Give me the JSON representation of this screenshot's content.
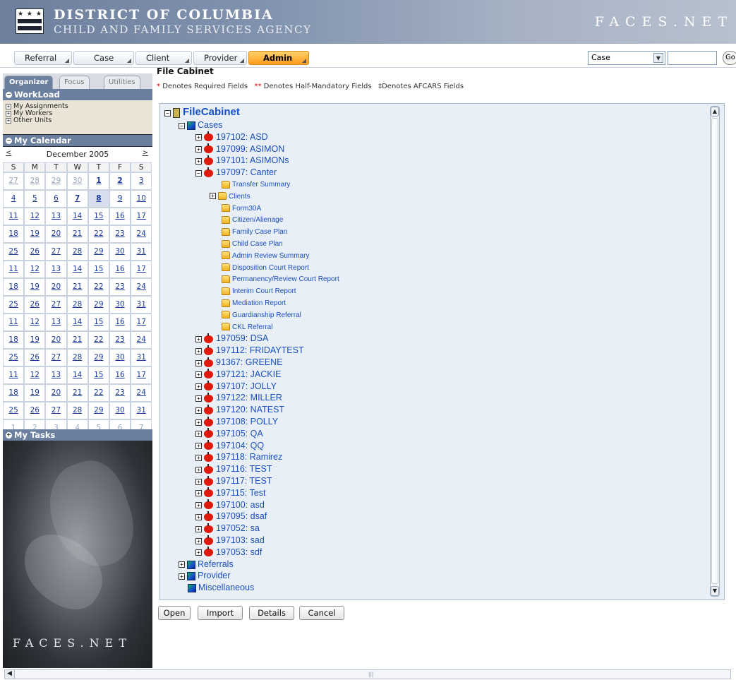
{
  "header": {
    "title_line1": "DISTRICT OF COLUMBIA",
    "title_line2": "CHILD AND FAMILY SERVICES AGENCY",
    "brand": "FACES.NET",
    "flag_stars": "★ ★ ★"
  },
  "menu": {
    "tabs": [
      {
        "label": "Referral",
        "active": false
      },
      {
        "label": "Case",
        "active": false
      },
      {
        "label": "Client",
        "active": false
      },
      {
        "label": "Provider",
        "active": false
      },
      {
        "label": "Admin",
        "active": true
      }
    ],
    "search_type": "Case",
    "search_value": "",
    "go_label": "Go"
  },
  "left": {
    "tabs": [
      "Organizer",
      "Focus",
      "Utilities"
    ],
    "workload_title": "WorkLoad",
    "workload_items": [
      "My Assignments",
      "My Workers",
      "Other Units"
    ],
    "calendar_title": "My Calendar",
    "calendar": {
      "month": "December 2005",
      "prev": "<",
      "next": ">",
      "days_of_week": [
        "S",
        "M",
        "T",
        "W",
        "T",
        "F",
        "S"
      ],
      "weeks": [
        [
          "27",
          "28",
          "29",
          "30",
          "1",
          "2",
          "3"
        ],
        [
          "4",
          "5",
          "6",
          "7",
          "8",
          "9",
          "10"
        ],
        [
          "11",
          "12",
          "13",
          "14",
          "15",
          "16",
          "17"
        ],
        [
          "18",
          "19",
          "20",
          "21",
          "22",
          "23",
          "24"
        ],
        [
          "25",
          "26",
          "27",
          "28",
          "29",
          "30",
          "31"
        ],
        [
          "11",
          "12",
          "13",
          "14",
          "15",
          "16",
          "17"
        ],
        [
          "18",
          "19",
          "20",
          "21",
          "22",
          "23",
          "24"
        ],
        [
          "25",
          "26",
          "27",
          "28",
          "29",
          "30",
          "31"
        ],
        [
          "11",
          "12",
          "13",
          "14",
          "15",
          "16",
          "17"
        ],
        [
          "18",
          "19",
          "20",
          "21",
          "22",
          "23",
          "24"
        ],
        [
          "25",
          "26",
          "27",
          "28",
          "29",
          "30",
          "31"
        ],
        [
          "11",
          "12",
          "13",
          "14",
          "15",
          "16",
          "17"
        ],
        [
          "18",
          "19",
          "20",
          "21",
          "22",
          "23",
          "24"
        ],
        [
          "25",
          "26",
          "27",
          "28",
          "29",
          "30",
          "31"
        ],
        [
          "1",
          "2",
          "3",
          "4",
          "5",
          "6",
          "7"
        ]
      ]
    },
    "tasks_title": "My Tasks",
    "photo_brand": "FACES.NET"
  },
  "main": {
    "title": "File Cabinet",
    "legend": {
      "required_mark": "*",
      "required_text": "Denotes Required Fields",
      "half_mark": "**",
      "half_text": "Denotes Half-Mandatory Fields",
      "afcars_mark": "‡",
      "afcars_text": "Denotes AFCARS Fields"
    },
    "tree": {
      "root": "FileCabinet",
      "cases_label": "Cases",
      "cases_before": [
        "197102: ASD",
        "197099: ASIMON",
        "197101: ASIMONs"
      ],
      "expanded_case": "197097: Canter",
      "expanded_docs": [
        "Transfer Summary",
        "Clients",
        "Form30A",
        "Citizen/Alienage",
        "Family Case Plan",
        "Child Case Plan",
        "Admin Review Summary",
        "Disposition Court Report",
        "Permanency/Review Court Report",
        "Interim Court Report",
        "Mediation Report",
        "Guardianship Referral",
        "CKL Referral"
      ],
      "cases_after": [
        "197059: DSA",
        "197112: FRIDAYTEST",
        "91367: GREENE",
        "197121: JACKIE",
        "197107: JOLLY",
        "197122: MILLER",
        "197120: NATEST",
        "197108: POLLY",
        "197105: QA",
        "197104: QQ",
        "197118: Ramirez",
        "197116: TEST",
        "197117: TEST",
        "197115: Test",
        "197100: asd",
        "197095: dsaf",
        "197052: sa",
        "197103: sad",
        "197053: sdf"
      ],
      "other_categories": [
        "Referrals",
        "Provider",
        "Miscellaneous"
      ]
    },
    "buttons": [
      "Open",
      "Import",
      "Details",
      "Cancel"
    ]
  }
}
